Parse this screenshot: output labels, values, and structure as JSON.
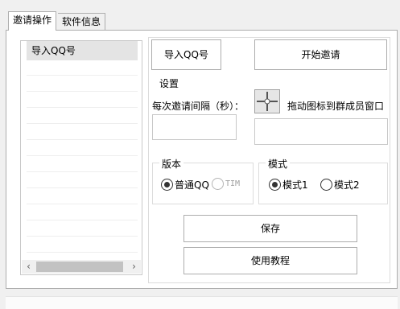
{
  "tabs": [
    {
      "label": "邀请操作",
      "active": true
    },
    {
      "label": "软件信息",
      "active": false
    }
  ],
  "list": {
    "header": "导入QQ号",
    "items": []
  },
  "buttons": {
    "import_qq": "导入QQ号",
    "start_invite": "开始邀请",
    "save": "保存",
    "tutorial": "使用教程"
  },
  "settings": {
    "title": "设置",
    "interval_label": "每次邀请间隔（秒）：",
    "interval_value": "",
    "drag_label": "拖动图标到群成员窗口",
    "window_value": ""
  },
  "version": {
    "title": "版本",
    "options": [
      {
        "label": "普通QQ",
        "checked": true,
        "enabled": true
      },
      {
        "label": "TIM",
        "checked": false,
        "enabled": false
      }
    ]
  },
  "mode": {
    "title": "模式",
    "options": [
      {
        "label": "模式1",
        "checked": true
      },
      {
        "label": "模式2",
        "checked": false
      }
    ]
  },
  "colors": {
    "window_bg": "#f0f0f0",
    "panel_bg": "#ffffff",
    "list_header_bg": "#e4e4e4",
    "border": "#adadad"
  },
  "icons": {
    "crosshair": "crosshair-drag-icon",
    "scroll_left": "chevron-left-icon",
    "scroll_right": "chevron-right-icon"
  }
}
